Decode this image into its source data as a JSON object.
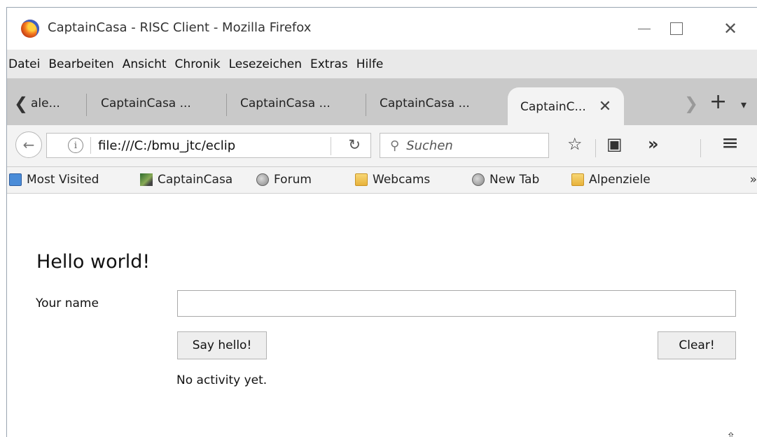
{
  "window": {
    "title": "CaptainCasa - RISC Client - Mozilla Firefox",
    "minimize_glyph": "",
    "close_glyph": "✕"
  },
  "menu": [
    "Datei",
    "Bearbeiten",
    "Ansicht",
    "Chronik",
    "Lesezeichen",
    "Extras",
    "Hilfe"
  ],
  "tabs": {
    "scroll_left": "❮",
    "items": [
      {
        "label": "ale..."
      },
      {
        "label": "CaptainCasa ..."
      },
      {
        "label": "CaptainCasa ..."
      },
      {
        "label": "CaptainCasa ..."
      }
    ],
    "active": {
      "label": "CaptainC...",
      "close": "✕"
    },
    "scroll_right": "❯",
    "new_tab": "+",
    "list_tabs": "▾"
  },
  "navbar": {
    "back": "←",
    "info": "i",
    "url": "file:///C:/bmu_jtc/eclip",
    "reload": "↻",
    "search_icon": "⚲",
    "search_placeholder": "Suchen",
    "bookmark_star": "☆",
    "reader": "▣",
    "overflow": "»",
    "menu": "≡"
  },
  "bookmarks": {
    "items": [
      {
        "label": "Most Visited",
        "icon": "most-visited-icon"
      },
      {
        "label": "CaptainCasa",
        "icon": "captaincasa-icon"
      },
      {
        "label": "Forum",
        "icon": "globe-icon"
      },
      {
        "label": "Webcams",
        "icon": "folder-icon"
      },
      {
        "label": "New Tab",
        "icon": "globe-icon"
      },
      {
        "label": "Alpenziele",
        "icon": "folder-icon"
      }
    ],
    "more": "»"
  },
  "page": {
    "heading": "Hello world!",
    "name_label": "Your name",
    "name_value": "",
    "say_hello": "Say hello!",
    "clear": "Clear!",
    "status": "No activity yet.",
    "resize_glyph": "⇳"
  }
}
